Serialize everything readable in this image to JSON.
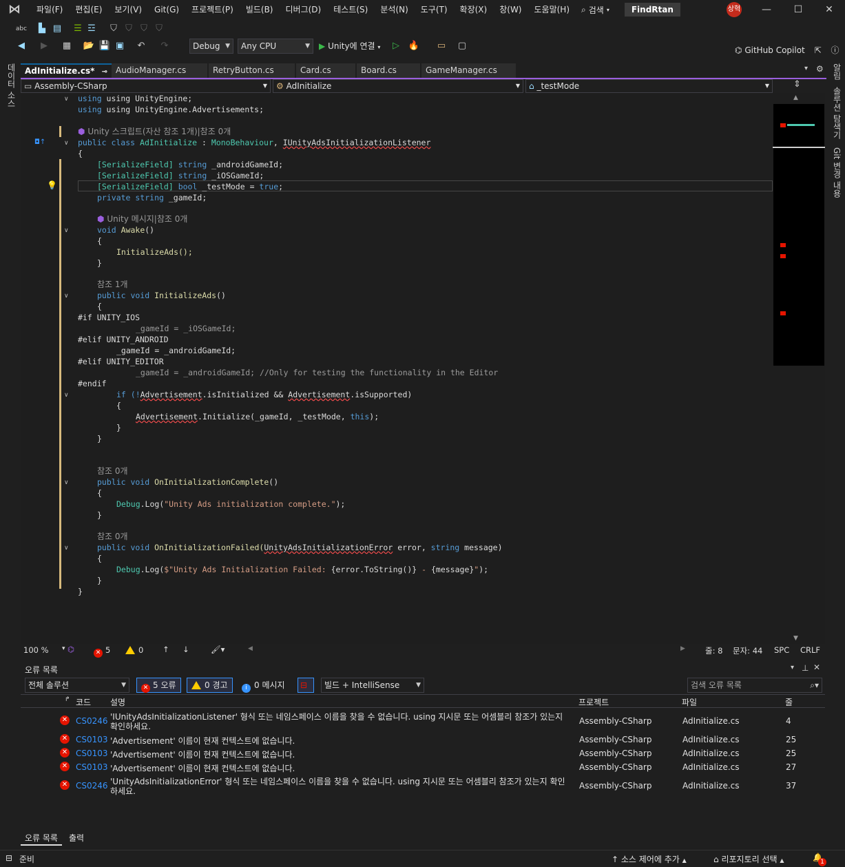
{
  "menu": [
    "파일(F)",
    "편집(E)",
    "보기(V)",
    "Git(G)",
    "프로젝트(P)",
    "빌드(B)",
    "디버그(D)",
    "테스트(S)",
    "분석(N)",
    "도구(T)",
    "확장(X)",
    "창(W)",
    "도움말(H)"
  ],
  "search_label": "검색",
  "solution_name": "FindRtan",
  "avatar_text": "상혁",
  "copilot_label": "GitHub Copilot",
  "toolbar": {
    "config": "Debug",
    "platform": "Any CPU",
    "run_label": "Unity에 연결"
  },
  "left_strip_label": "데이터 소스",
  "right_strip": [
    "알림",
    "솔루션 탐색기",
    "Git 변경 내용"
  ],
  "tabs": [
    "AdInitialize.cs*",
    "AudioManager.cs",
    "RetryButton.cs",
    "Card.cs",
    "Board.cs",
    "GameManager.cs"
  ],
  "nav": {
    "project": "Assembly-CSharp",
    "class": "AdInitialize",
    "member": "_testMode"
  },
  "code": {
    "l1": "using UnityEngine;",
    "l2": "using UnityEngine.Advertisements;",
    "lens1": "Unity 스크립트(자산 참조 1개)|참조 0개",
    "l4a": "public class ",
    "l4b": "AdInitialize",
    "l4c": " : ",
    "l4d": "MonoBehaviour",
    "l4e": ", ",
    "l4f": "IUnityAdsInitializationListener",
    "l5": "{",
    "l6a": "[SerializeField] ",
    "l6b": "string",
    "l6c": " _androidGameId;",
    "l7a": "[SerializeField] ",
    "l7b": "string",
    "l7c": " _iOSGameId;",
    "l8a": "[SerializeField] ",
    "l8b": "bool",
    "l8c": " _testMode = ",
    "l8d": "true",
    "l8e": ";",
    "l9a": "private string",
    "l9b": " _gameId;",
    "lens2": "Unity 메시지|참조 0개",
    "l11a": "void ",
    "l11b": "Awake",
    "l11c": "()",
    "l12": "{",
    "l13": "InitializeAds();",
    "l14": "}",
    "lens3": "참조 1개",
    "l16a": "public void ",
    "l16b": "InitializeAds",
    "l16c": "()",
    "l17": "{",
    "l18": "#if UNITY_IOS",
    "l19": "_gameId = _iOSGameId;",
    "l20": "#elif UNITY_ANDROID",
    "l21": "_gameId = _androidGameId;",
    "l22": "#elif UNITY_EDITOR",
    "l23a": "_gameId = _androidGameId; ",
    "l23b": "//Only for testing the functionality in the Editor",
    "l24": "#endif",
    "l25a": "if (!",
    "l25b": "Advertisement",
    "l25c": ".isInitialized && ",
    "l25d": "Advertisement",
    "l25e": ".isSupported)",
    "l26": "{",
    "l27a": "Advertisement",
    "l27b": ".Initialize(_gameId, _testMode, ",
    "l27c": "this",
    "l27d": ");",
    "l28": "}",
    "l29": "}",
    "lens4": "참조 0개",
    "l31a": "public void ",
    "l31b": "OnInitializationComplete",
    "l31c": "()",
    "l32": "{",
    "l33a": "Debug",
    "l33b": ".Log(",
    "l33c": "\"Unity Ads initialization complete.\"",
    "l33d": ");",
    "l34": "}",
    "lens5": "참조 0개",
    "l36a": "public void ",
    "l36b": "OnInitializationFailed(",
    "l36c": "UnityAdsInitializationError",
    "l36d": " error, ",
    "l36e": "string",
    "l36f": " message)",
    "l37": "{",
    "l38a": "Debug",
    "l38b": ".Log(",
    "l38c": "$\"Unity Ads Initialization Failed: ",
    "l38d": "{error.ToString()}",
    "l38e": " - ",
    "l38f": "{message}",
    "l38g": "\"",
    "l38h": ");",
    "l39": "}",
    "l40": "}"
  },
  "editor_status": {
    "zoom": "100 %",
    "errors": "5",
    "warnings": "0",
    "line": "줄: 8",
    "col": "문자: 44",
    "spc": "SPC",
    "eol": "CRLF"
  },
  "error_list": {
    "title": "오류 목록",
    "scope": "전체 솔루션",
    "errors_pill": "5 오류",
    "warnings_pill": "0 경고",
    "messages_pill": "0 메시지",
    "build_filter": "빌드 + IntelliSense",
    "search_placeholder": "검색 오류 목록",
    "headers": [
      "코드",
      "설명",
      "프로젝트",
      "파일",
      "줄"
    ],
    "rows": [
      {
        "code": "CS0246",
        "desc1": "'IUnityAdsInitializationListener' 형식 또는 네임스페이스 이름을 찾을 수 없습니다. using 지시문 또는 어셈블리 참조가 있는지",
        "desc2": "확인하세요.",
        "project": "Assembly-CSharp",
        "file": "AdInitialize.cs",
        "line": "4"
      },
      {
        "code": "CS0103",
        "desc1": "'Advertisement' 이름이 현재 컨텍스트에 없습니다.",
        "desc2": "",
        "project": "Assembly-CSharp",
        "file": "AdInitialize.cs",
        "line": "25"
      },
      {
        "code": "CS0103",
        "desc1": "'Advertisement' 이름이 현재 컨텍스트에 없습니다.",
        "desc2": "",
        "project": "Assembly-CSharp",
        "file": "AdInitialize.cs",
        "line": "25"
      },
      {
        "code": "CS0103",
        "desc1": "'Advertisement' 이름이 현재 컨텍스트에 없습니다.",
        "desc2": "",
        "project": "Assembly-CSharp",
        "file": "AdInitialize.cs",
        "line": "27"
      },
      {
        "code": "CS0246",
        "desc1": "'UnityAdsInitializationError' 형식 또는 네임스페이스 이름을 찾을 수 없습니다. using 지시문 또는 어셈블리 참조가 있는지 확인",
        "desc2": "하세요.",
        "project": "Assembly-CSharp",
        "file": "AdInitialize.cs",
        "line": "37"
      }
    ],
    "tabs": [
      "오류 목록",
      "출력"
    ]
  },
  "status": {
    "ready": "준비",
    "source_control": "소스 제어에 추가",
    "repo": "리포지토리 선택",
    "notif_count": "1"
  },
  "colors": {
    "accent": "#9b5fde",
    "error": "#e51400",
    "link": "#3794ff",
    "warning": "#ffcc00"
  }
}
